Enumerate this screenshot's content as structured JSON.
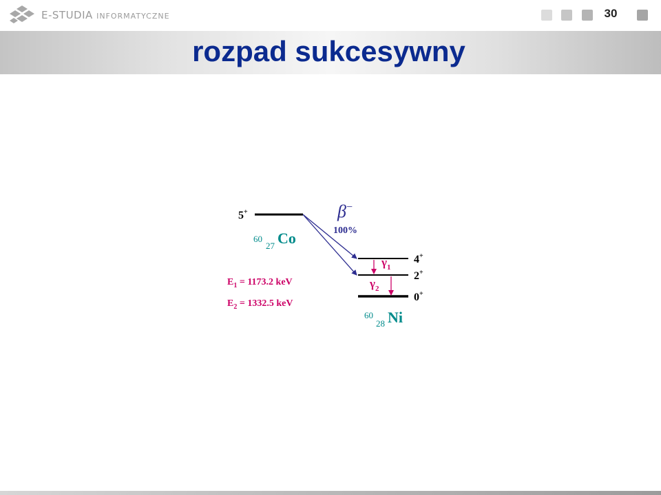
{
  "header": {
    "brand_main": "E-STUDIA",
    "brand_sub": "INFORMATYCZNE",
    "page_number": "30"
  },
  "slide": {
    "title": "rozpad sukcesywny"
  },
  "diagram": {
    "parent": {
      "mass": "60",
      "z": "27",
      "symbol": "Co",
      "spin": "5",
      "parity": "+"
    },
    "decay": {
      "symbol": "β",
      "sign": "−",
      "branch": "100%"
    },
    "daughter": {
      "mass": "60",
      "z": "28",
      "symbol": "Ni",
      "levels": [
        {
          "spin": "4",
          "parity": "+"
        },
        {
          "spin": "2",
          "parity": "+"
        },
        {
          "spin": "0",
          "parity": "+"
        }
      ]
    },
    "gammas": [
      {
        "symbol": "γ",
        "index": "1"
      },
      {
        "symbol": "γ",
        "index": "2"
      }
    ],
    "energies": [
      {
        "letter": "E",
        "index": "1",
        "value": " = 1173.2 keV"
      },
      {
        "letter": "E",
        "index": "2",
        "value": " = 1332.5 keV"
      }
    ],
    "colors": {
      "teal": "#008b8b",
      "magenta": "#cc0066",
      "arrow": "#2d2d90",
      "level": "#000000"
    }
  }
}
